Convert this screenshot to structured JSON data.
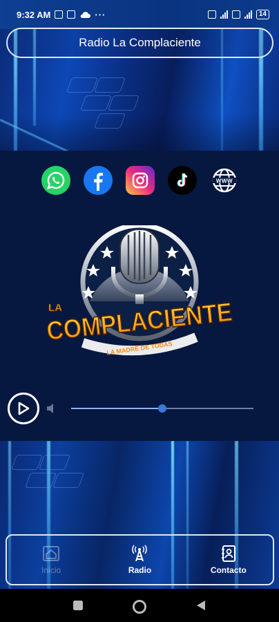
{
  "status": {
    "time": "9:32 AM",
    "battery": "14"
  },
  "header": {
    "title": "Radio La Complaciente"
  },
  "social": [
    {
      "name": "whatsapp-icon"
    },
    {
      "name": "facebook-icon"
    },
    {
      "name": "instagram-icon"
    },
    {
      "name": "tiktok-icon"
    },
    {
      "name": "website-globe-icon"
    }
  ],
  "logo": {
    "line1": "LA",
    "line2": "COMPLACIENTE",
    "tagline": "LA MADRE DE TODAS"
  },
  "player": {
    "state": "paused",
    "volume_fraction": 0.5
  },
  "nav": {
    "items": [
      {
        "label": "Inicio",
        "active": false
      },
      {
        "label": "Radio",
        "active": true
      },
      {
        "label": "Contacto",
        "active": true
      }
    ]
  },
  "colors": {
    "background": "#06183f",
    "accent_orange": "#f7a11a",
    "accent_blue": "#3c78d8"
  }
}
